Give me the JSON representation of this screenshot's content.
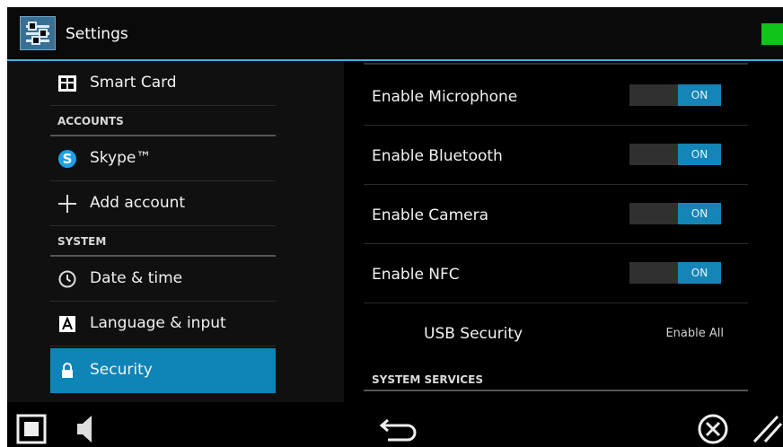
{
  "app": {
    "title": "Settings",
    "status_color": "#11c41a"
  },
  "sidebar": {
    "items": [
      {
        "kind": "item",
        "label": "Smart Card",
        "icon": "smart-card-icon"
      },
      {
        "kind": "header",
        "label": "ACCOUNTS"
      },
      {
        "kind": "item",
        "label": "Skype™",
        "icon": "skype-icon"
      },
      {
        "kind": "item",
        "label": "Add account",
        "icon": "plus-icon"
      },
      {
        "kind": "header",
        "label": "SYSTEM"
      },
      {
        "kind": "item",
        "label": "Date & time",
        "icon": "clock-icon"
      },
      {
        "kind": "item",
        "label": "Language & input",
        "icon": "keyboard-icon"
      },
      {
        "kind": "item",
        "label": "Security",
        "icon": "lock-icon",
        "selected": true
      }
    ]
  },
  "main": {
    "toggles": [
      {
        "label": "Enable Microphone",
        "state": "ON"
      },
      {
        "label": "Enable Bluetooth",
        "state": "ON"
      },
      {
        "label": "Enable Camera",
        "state": "ON"
      },
      {
        "label": "Enable NFC",
        "state": "ON"
      }
    ],
    "usb": {
      "label": "USB Security",
      "value": "Enable All"
    },
    "section_header": "SYSTEM SERVICES"
  },
  "navbar": {
    "icons": [
      "square-icon",
      "volume-icon",
      "back-icon",
      "close-circle-icon",
      "resize-icon"
    ]
  },
  "colors": {
    "accent": "#33b5e5",
    "selected": "#0f84b8",
    "switch_on": "#1585b8"
  }
}
